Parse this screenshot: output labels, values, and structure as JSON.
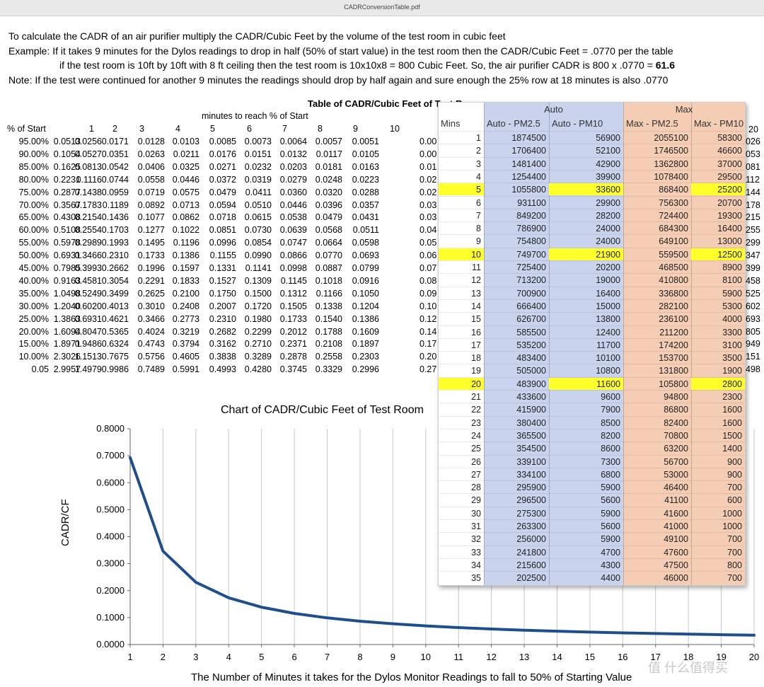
{
  "window_title": "CADRConversionTable.pdf",
  "intro": [
    "To calculate the CADR of an air purifier multiply the CADR/Cubic Feet by the volume of the test room in cubic feet",
    "Example: If it takes 9 minutes for the Dylos readings to drop in half (50% of start value) in the test room then the CADR/Cubic Feet = .0770 per the table",
    "if the test room is 10ft by 10ft with 8 ft ceiling then the test room is 10x10x8 = 800 Cubic Feet.  So, the air purifier CADR is  800 x .0770 = ",
    "61.6",
    "Note: If the test were continued for another 9 minutes the readings should drop by half again and sure enough the 25% row at 18 minutes is also .0770"
  ],
  "table": {
    "title": "Table of CADR/Cubic Feet of Test R",
    "subtitle": "minutes to reach % of Start",
    "corner": "% of Start",
    "minutes": [
      "1",
      "2",
      "3",
      "4",
      "5",
      "6",
      "7",
      "8",
      "9",
      "10",
      "20"
    ],
    "rows": [
      {
        "pct": "95.00%",
        "v": [
          "0.0513",
          "0.0256",
          "0.0171",
          "0.0128",
          "0.0103",
          "0.0085",
          "0.0073",
          "0.0064",
          "0.0057",
          "0.0051",
          "0.00"
        ],
        "r": "026"
      },
      {
        "pct": "90.00%",
        "v": [
          "0.1054",
          "0.0527",
          "0.0351",
          "0.0263",
          "0.0211",
          "0.0176",
          "0.0151",
          "0.0132",
          "0.0117",
          "0.0105",
          "0.00"
        ],
        "r": "053"
      },
      {
        "pct": "85.00%",
        "v": [
          "0.1625",
          "0.0813",
          "0.0542",
          "0.0406",
          "0.0325",
          "0.0271",
          "0.0232",
          "0.0203",
          "0.0181",
          "0.0163",
          "0.01"
        ],
        "r": "081"
      },
      {
        "pct": "80.00%",
        "v": [
          "0.2231",
          "0.1116",
          "0.0744",
          "0.0558",
          "0.0446",
          "0.0372",
          "0.0319",
          "0.0279",
          "0.0248",
          "0.0223",
          "0.02"
        ],
        "r": "112"
      },
      {
        "pct": "75.00%",
        "v": [
          "0.2877",
          "0.1438",
          "0.0959",
          "0.0719",
          "0.0575",
          "0.0479",
          "0.0411",
          "0.0360",
          "0.0320",
          "0.0288",
          "0.02"
        ],
        "r": "144"
      },
      {
        "pct": "70.00%",
        "v": [
          "0.3567",
          "0.1783",
          "0.1189",
          "0.0892",
          "0.0713",
          "0.0594",
          "0.0510",
          "0.0446",
          "0.0396",
          "0.0357",
          "0.03"
        ],
        "r": "178"
      },
      {
        "pct": "65.00%",
        "v": [
          "0.4308",
          "0.2154",
          "0.1436",
          "0.1077",
          "0.0862",
          "0.0718",
          "0.0615",
          "0.0538",
          "0.0479",
          "0.0431",
          "0.03"
        ],
        "r": "215"
      },
      {
        "pct": "60.00%",
        "v": [
          "0.5108",
          "0.2554",
          "0.1703",
          "0.1277",
          "0.1022",
          "0.0851",
          "0.0730",
          "0.0639",
          "0.0568",
          "0.0511",
          "0.04"
        ],
        "r": "255"
      },
      {
        "pct": "55.00%",
        "v": [
          "0.5978",
          "0.2989",
          "0.1993",
          "0.1495",
          "0.1196",
          "0.0996",
          "0.0854",
          "0.0747",
          "0.0664",
          "0.0598",
          "0.05"
        ],
        "r": "299"
      },
      {
        "pct": "50.00%",
        "v": [
          "0.6931",
          "0.3466",
          "0.2310",
          "0.1733",
          "0.1386",
          "0.1155",
          "0.0990",
          "0.0866",
          "0.0770",
          "0.0693",
          "0.06"
        ],
        "r": "347"
      },
      {
        "pct": "45.00%",
        "v": [
          "0.7985",
          "0.3993",
          "0.2662",
          "0.1996",
          "0.1597",
          "0.1331",
          "0.1141",
          "0.0998",
          "0.0887",
          "0.0799",
          "0.07"
        ],
        "r": "399"
      },
      {
        "pct": "40.00%",
        "v": [
          "0.9163",
          "0.4581",
          "0.3054",
          "0.2291",
          "0.1833",
          "0.1527",
          "0.1309",
          "0.1145",
          "0.1018",
          "0.0916",
          "0.08"
        ],
        "r": "458"
      },
      {
        "pct": "35.00%",
        "v": [
          "1.0498",
          "0.5249",
          "0.3499",
          "0.2625",
          "0.2100",
          "0.1750",
          "0.1500",
          "0.1312",
          "0.1166",
          "0.1050",
          "0.09"
        ],
        "r": "525"
      },
      {
        "pct": "30.00%",
        "v": [
          "1.2040",
          "0.6020",
          "0.4013",
          "0.3010",
          "0.2408",
          "0.2007",
          "0.1720",
          "0.1505",
          "0.1338",
          "0.1204",
          "0.10"
        ],
        "r": "602"
      },
      {
        "pct": "25.00%",
        "v": [
          "1.3863",
          "0.6931",
          "0.4621",
          "0.3466",
          "0.2773",
          "0.2310",
          "0.1980",
          "0.1733",
          "0.1540",
          "0.1386",
          "0.12"
        ],
        "r": "693"
      },
      {
        "pct": "20.00%",
        "v": [
          "1.6094",
          "0.8047",
          "0.5365",
          "0.4024",
          "0.3219",
          "0.2682",
          "0.2299",
          "0.2012",
          "0.1788",
          "0.1609",
          "0.14"
        ],
        "r": "805"
      },
      {
        "pct": "15.00%",
        "v": [
          "1.8971",
          "0.9486",
          "0.6324",
          "0.4743",
          "0.3794",
          "0.3162",
          "0.2710",
          "0.2371",
          "0.2108",
          "0.1897",
          "0.17"
        ],
        "r": "949"
      },
      {
        "pct": "10.00%",
        "v": [
          "2.3026",
          "1.1513",
          "0.7675",
          "0.5756",
          "0.4605",
          "0.3838",
          "0.3289",
          "0.2878",
          "0.2558",
          "0.2303",
          "0.20"
        ],
        "r": "151"
      },
      {
        "pct": "0.05",
        "v": [
          "2.9957",
          "1.4979",
          "0.9986",
          "0.7489",
          "0.5991",
          "0.4993",
          "0.4280",
          "0.3745",
          "0.3329",
          "0.2996",
          "0.27"
        ],
        "r": "498"
      }
    ]
  },
  "sheet": {
    "group_auto": "Auto",
    "group_max": "Max",
    "headers": [
      "Mins",
      "Auto - PM2.5",
      "Auto - PM10",
      "Max - PM2.5",
      "Max - PM10"
    ],
    "colors": {
      "auto_band": "#c9d3ee",
      "max_band": "#f4cdb4",
      "highlight": "#ffff2a"
    },
    "rows": [
      [
        "1",
        "1874500",
        "56900",
        "2055100",
        "58300"
      ],
      [
        "2",
        "1706400",
        "52100",
        "1746500",
        "46600"
      ],
      [
        "3",
        "1481400",
        "42900",
        "1362800",
        "37000"
      ],
      [
        "4",
        "1254400",
        "39900",
        "1078400",
        "29500"
      ],
      [
        "5",
        "1055800",
        "33600",
        "868400",
        "25200"
      ],
      [
        "6",
        "931100",
        "29900",
        "756300",
        "20700"
      ],
      [
        "7",
        "849200",
        "28200",
        "724400",
        "19300"
      ],
      [
        "8",
        "786900",
        "24000",
        "684300",
        "16400"
      ],
      [
        "9",
        "754800",
        "24000",
        "649100",
        "13000"
      ],
      [
        "10",
        "749700",
        "21900",
        "559500",
        "12500"
      ],
      [
        "11",
        "725400",
        "20200",
        "468500",
        "8900"
      ],
      [
        "12",
        "713200",
        "19000",
        "410800",
        "8100"
      ],
      [
        "13",
        "700900",
        "16400",
        "336800",
        "5900"
      ],
      [
        "14",
        "666400",
        "15000",
        "282100",
        "5300"
      ],
      [
        "15",
        "626700",
        "13800",
        "236100",
        "4000"
      ],
      [
        "16",
        "585500",
        "12400",
        "211200",
        "3300"
      ],
      [
        "17",
        "535200",
        "11700",
        "174200",
        "3100"
      ],
      [
        "18",
        "483400",
        "10100",
        "153700",
        "3500"
      ],
      [
        "19",
        "505000",
        "10800",
        "131800",
        "1900"
      ],
      [
        "20",
        "483900",
        "11600",
        "105800",
        "2800"
      ],
      [
        "21",
        "433600",
        "9600",
        "94800",
        "2300"
      ],
      [
        "22",
        "415900",
        "7900",
        "86800",
        "1600"
      ],
      [
        "23",
        "380400",
        "8500",
        "82400",
        "1600"
      ],
      [
        "24",
        "365500",
        "8200",
        "70800",
        "1500"
      ],
      [
        "25",
        "354500",
        "8600",
        "63200",
        "1400"
      ],
      [
        "26",
        "339100",
        "7300",
        "56700",
        "900"
      ],
      [
        "27",
        "334100",
        "6800",
        "53000",
        "900"
      ],
      [
        "28",
        "295900",
        "5900",
        "46400",
        "700"
      ],
      [
        "29",
        "296500",
        "5600",
        "41100",
        "600"
      ],
      [
        "30",
        "275300",
        "5900",
        "41600",
        "1000"
      ],
      [
        "31",
        "263300",
        "5600",
        "41000",
        "1000"
      ],
      [
        "32",
        "256000",
        "5900",
        "49100",
        "700"
      ],
      [
        "33",
        "241800",
        "4700",
        "47600",
        "700"
      ],
      [
        "34",
        "215600",
        "4300",
        "47500",
        "800"
      ],
      [
        "35",
        "202500",
        "4400",
        "46000",
        "700"
      ]
    ],
    "highlight_rows": [
      "5",
      "10",
      "20"
    ]
  },
  "chart_data": {
    "type": "line",
    "title": "Chart of CADR/Cubic Feet of Test Room",
    "xlabel": "The Number of Minutes it takes for the Dylos Monitor Readings to fall to 50% of Starting Value",
    "ylabel": "CADR/CF",
    "x": [
      1,
      2,
      3,
      4,
      5,
      6,
      7,
      8,
      9,
      10,
      11,
      12,
      13,
      14,
      15,
      16,
      17,
      18,
      19,
      20
    ],
    "series": [
      {
        "values": [
          0.6931,
          0.3466,
          0.231,
          0.1733,
          0.1386,
          0.1155,
          0.099,
          0.0866,
          0.077,
          0.0693,
          0.063,
          0.0578,
          0.0533,
          0.0495,
          0.0462,
          0.0433,
          0.0408,
          0.0385,
          0.0365,
          0.0347
        ],
        "color": "#1f4e8c"
      }
    ],
    "yticks": [
      "0.0000",
      "0.1000",
      "0.2000",
      "0.3000",
      "0.4000",
      "0.5000",
      "0.6000",
      "0.7000",
      "0.8000"
    ],
    "xticks": [
      "1",
      "2",
      "3",
      "4",
      "5",
      "6",
      "7",
      "8",
      "9",
      "10",
      "11",
      "12",
      "13",
      "14",
      "15",
      "16",
      "17",
      "18",
      "19",
      "20"
    ],
    "xlim": [
      1,
      20
    ],
    "ylim": [
      0,
      0.8
    ],
    "grid": "vertical"
  },
  "watermark": "值 什么值得买"
}
